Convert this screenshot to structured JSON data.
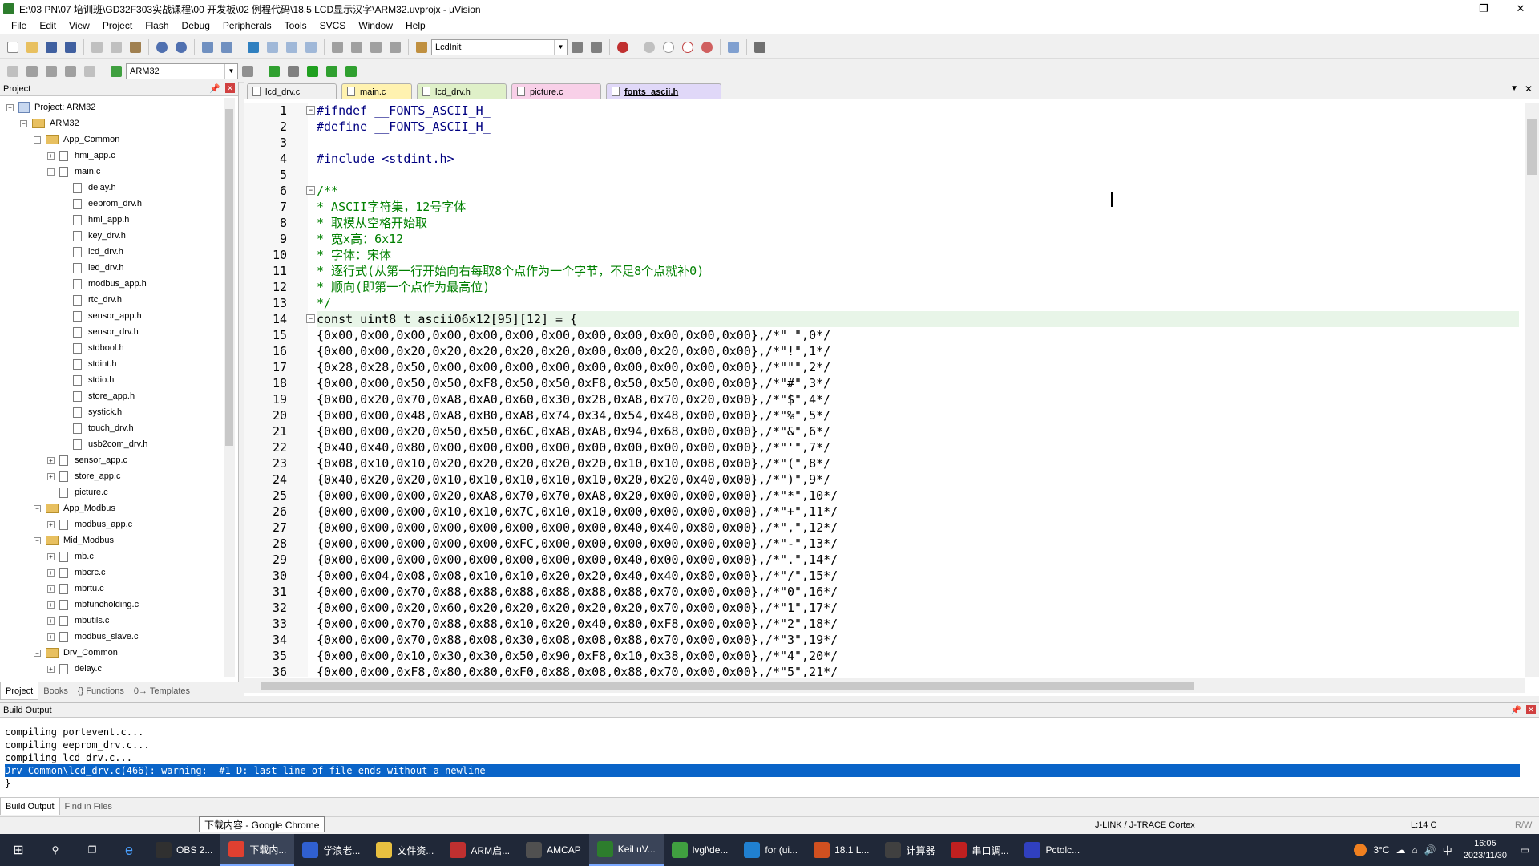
{
  "window": {
    "title": "E:\\03 PN\\07 培训班\\GD32F303实战课程\\00 开发板\\02 例程代码\\18.5 LCD显示汉字\\ARM32.uvprojx - µVision",
    "min": "–",
    "max": "❐",
    "close": "✕"
  },
  "menu": [
    "File",
    "Edit",
    "View",
    "Project",
    "Flash",
    "Debug",
    "Peripherals",
    "Tools",
    "SVCS",
    "Window",
    "Help"
  ],
  "toolbar1": {
    "function_combo": "LcdInit"
  },
  "toolbar2": {
    "target_combo": "ARM32"
  },
  "project_panel": {
    "title": "Project",
    "tree": [
      {
        "label": "Project: ARM32",
        "depth": 0,
        "exp": "−",
        "kind": "proj"
      },
      {
        "label": "ARM32",
        "depth": 1,
        "exp": "−",
        "kind": "dir"
      },
      {
        "label": "App_Common",
        "depth": 2,
        "exp": "−",
        "kind": "dir"
      },
      {
        "label": "hmi_app.c",
        "depth": 3,
        "exp": "+",
        "kind": "file"
      },
      {
        "label": "main.c",
        "depth": 3,
        "exp": "−",
        "kind": "file"
      },
      {
        "label": "delay.h",
        "depth": 4,
        "exp": "",
        "kind": "file"
      },
      {
        "label": "eeprom_drv.h",
        "depth": 4,
        "exp": "",
        "kind": "file"
      },
      {
        "label": "hmi_app.h",
        "depth": 4,
        "exp": "",
        "kind": "file"
      },
      {
        "label": "key_drv.h",
        "depth": 4,
        "exp": "",
        "kind": "file"
      },
      {
        "label": "lcd_drv.h",
        "depth": 4,
        "exp": "",
        "kind": "file"
      },
      {
        "label": "led_drv.h",
        "depth": 4,
        "exp": "",
        "kind": "file"
      },
      {
        "label": "modbus_app.h",
        "depth": 4,
        "exp": "",
        "kind": "file"
      },
      {
        "label": "rtc_drv.h",
        "depth": 4,
        "exp": "",
        "kind": "file"
      },
      {
        "label": "sensor_app.h",
        "depth": 4,
        "exp": "",
        "kind": "file"
      },
      {
        "label": "sensor_drv.h",
        "depth": 4,
        "exp": "",
        "kind": "file"
      },
      {
        "label": "stdbool.h",
        "depth": 4,
        "exp": "",
        "kind": "file"
      },
      {
        "label": "stdint.h",
        "depth": 4,
        "exp": "",
        "kind": "file"
      },
      {
        "label": "stdio.h",
        "depth": 4,
        "exp": "",
        "kind": "file"
      },
      {
        "label": "store_app.h",
        "depth": 4,
        "exp": "",
        "kind": "file"
      },
      {
        "label": "systick.h",
        "depth": 4,
        "exp": "",
        "kind": "file"
      },
      {
        "label": "touch_drv.h",
        "depth": 4,
        "exp": "",
        "kind": "file"
      },
      {
        "label": "usb2com_drv.h",
        "depth": 4,
        "exp": "",
        "kind": "file"
      },
      {
        "label": "sensor_app.c",
        "depth": 3,
        "exp": "+",
        "kind": "file"
      },
      {
        "label": "store_app.c",
        "depth": 3,
        "exp": "+",
        "kind": "file"
      },
      {
        "label": "picture.c",
        "depth": 3,
        "exp": "",
        "kind": "file"
      },
      {
        "label": "App_Modbus",
        "depth": 2,
        "exp": "−",
        "kind": "dir"
      },
      {
        "label": "modbus_app.c",
        "depth": 3,
        "exp": "+",
        "kind": "file"
      },
      {
        "label": "Mid_Modbus",
        "depth": 2,
        "exp": "−",
        "kind": "dir"
      },
      {
        "label": "mb.c",
        "depth": 3,
        "exp": "+",
        "kind": "file"
      },
      {
        "label": "mbcrc.c",
        "depth": 3,
        "exp": "+",
        "kind": "file"
      },
      {
        "label": "mbrtu.c",
        "depth": 3,
        "exp": "+",
        "kind": "file"
      },
      {
        "label": "mbfuncholding.c",
        "depth": 3,
        "exp": "+",
        "kind": "file"
      },
      {
        "label": "mbutils.c",
        "depth": 3,
        "exp": "+",
        "kind": "file"
      },
      {
        "label": "modbus_slave.c",
        "depth": 3,
        "exp": "+",
        "kind": "file"
      },
      {
        "label": "Drv_Common",
        "depth": 2,
        "exp": "−",
        "kind": "dir"
      },
      {
        "label": "delay.c",
        "depth": 3,
        "exp": "+",
        "kind": "file"
      }
    ],
    "bottom_tabs": [
      "Project",
      "Books",
      "{} Functions",
      "0→ Templates"
    ]
  },
  "editor": {
    "tabs": [
      {
        "label": "lcd_drv.c",
        "color": "#f0f0f0"
      },
      {
        "label": "main.c",
        "color": "#fff2b0"
      },
      {
        "label": "lcd_drv.h",
        "color": "#dff0c8"
      },
      {
        "label": "picture.c",
        "color": "#f8d0e8"
      },
      {
        "label": "fonts_ascii.h",
        "color": "#e0d8f8"
      }
    ],
    "active_tab": "fonts_ascii.h",
    "lines": [
      {
        "n": "1",
        "t": "#ifndef __FONTS_ASCII_H_",
        "c": "pp",
        "fold": "−"
      },
      {
        "n": "2",
        "t": "#define __FONTS_ASCII_H_",
        "c": "pp"
      },
      {
        "n": "3",
        "t": ""
      },
      {
        "n": "4",
        "t": "#include <stdint.h>",
        "c": "pp"
      },
      {
        "n": "5",
        "t": ""
      },
      {
        "n": "6",
        "t": "/**",
        "c": "cm",
        "fold": "−"
      },
      {
        "n": "7",
        "t": "* ASCII字符集，12号字体",
        "c": "cm"
      },
      {
        "n": "8",
        "t": "* 取模从空格开始取",
        "c": "cm"
      },
      {
        "n": "9",
        "t": "* 宽x高：6x12",
        "c": "cm"
      },
      {
        "n": "10",
        "t": "* 字体：宋体",
        "c": "cm"
      },
      {
        "n": "11",
        "t": "* 逐行式(从第一行开始向右每取8个点作为一个字节，不足8个点就补0)",
        "c": "cm"
      },
      {
        "n": "12",
        "t": "* 顺向(即第一个点作为最高位)",
        "c": "cm"
      },
      {
        "n": "13",
        "t": "*/",
        "c": "cm"
      },
      {
        "n": "14",
        "t": "const uint8_t ascii06x12[95][12] = {",
        "hl": true,
        "fold": "−"
      },
      {
        "n": "15",
        "t": "{0x00,0x00,0x00,0x00,0x00,0x00,0x00,0x00,0x00,0x00,0x00,0x00},/*\" \",0*/"
      },
      {
        "n": "16",
        "t": "{0x00,0x00,0x20,0x20,0x20,0x20,0x20,0x00,0x00,0x20,0x00,0x00},/*\"!\",1*/"
      },
      {
        "n": "17",
        "t": "{0x28,0x28,0x50,0x00,0x00,0x00,0x00,0x00,0x00,0x00,0x00,0x00},/*\"\"\",2*/"
      },
      {
        "n": "18",
        "t": "{0x00,0x00,0x50,0x50,0xF8,0x50,0x50,0xF8,0x50,0x50,0x00,0x00},/*\"#\",3*/"
      },
      {
        "n": "19",
        "t": "{0x00,0x20,0x70,0xA8,0xA0,0x60,0x30,0x28,0xA8,0x70,0x20,0x00},/*\"$\",4*/"
      },
      {
        "n": "20",
        "t": "{0x00,0x00,0x48,0xA8,0xB0,0xA8,0x74,0x34,0x54,0x48,0x00,0x00},/*\"%\",5*/"
      },
      {
        "n": "21",
        "t": "{0x00,0x00,0x20,0x50,0x50,0x6C,0xA8,0xA8,0x94,0x68,0x00,0x00},/*\"&\",6*/"
      },
      {
        "n": "22",
        "t": "{0x40,0x40,0x80,0x00,0x00,0x00,0x00,0x00,0x00,0x00,0x00,0x00},/*\"'\",7*/"
      },
      {
        "n": "23",
        "t": "{0x08,0x10,0x10,0x20,0x20,0x20,0x20,0x20,0x10,0x10,0x08,0x00},/*\"(\",8*/"
      },
      {
        "n": "24",
        "t": "{0x40,0x20,0x20,0x10,0x10,0x10,0x10,0x10,0x20,0x20,0x40,0x00},/*\")\",9*/"
      },
      {
        "n": "25",
        "t": "{0x00,0x00,0x00,0x20,0xA8,0x70,0x70,0xA8,0x20,0x00,0x00,0x00},/*\"*\",10*/"
      },
      {
        "n": "26",
        "t": "{0x00,0x00,0x00,0x10,0x10,0x7C,0x10,0x10,0x00,0x00,0x00,0x00},/*\"+\",11*/"
      },
      {
        "n": "27",
        "t": "{0x00,0x00,0x00,0x00,0x00,0x00,0x00,0x00,0x40,0x40,0x80,0x00},/*\",\",12*/"
      },
      {
        "n": "28",
        "t": "{0x00,0x00,0x00,0x00,0x00,0xFC,0x00,0x00,0x00,0x00,0x00,0x00},/*\"-\",13*/"
      },
      {
        "n": "29",
        "t": "{0x00,0x00,0x00,0x00,0x00,0x00,0x00,0x00,0x40,0x00,0x00,0x00},/*\".\",14*/"
      },
      {
        "n": "30",
        "t": "{0x00,0x04,0x08,0x08,0x10,0x10,0x20,0x20,0x40,0x40,0x80,0x00},/*\"/\",15*/"
      },
      {
        "n": "31",
        "t": "{0x00,0x00,0x70,0x88,0x88,0x88,0x88,0x88,0x88,0x70,0x00,0x00},/*\"0\",16*/"
      },
      {
        "n": "32",
        "t": "{0x00,0x00,0x20,0x60,0x20,0x20,0x20,0x20,0x20,0x70,0x00,0x00},/*\"1\",17*/"
      },
      {
        "n": "33",
        "t": "{0x00,0x00,0x70,0x88,0x88,0x10,0x20,0x40,0x80,0xF8,0x00,0x00},/*\"2\",18*/"
      },
      {
        "n": "34",
        "t": "{0x00,0x00,0x70,0x88,0x08,0x30,0x08,0x08,0x88,0x70,0x00,0x00},/*\"3\",19*/"
      },
      {
        "n": "35",
        "t": "{0x00,0x00,0x10,0x30,0x30,0x50,0x90,0xF8,0x10,0x38,0x00,0x00},/*\"4\",20*/"
      },
      {
        "n": "36",
        "t": "{0x00,0x00,0xF8,0x80,0x80,0xF0,0x88,0x08,0x88,0x70,0x00,0x00},/*\"5\",21*/"
      }
    ]
  },
  "build_output": {
    "title": "Build Output",
    "lines": [
      "compiling portevent.c...",
      "compiling eeprom_drv.c...",
      "compiling lcd_drv.c...",
      "Drv Common\\lcd_drv.c(466): warning:  #1-D: last line of file ends without a newline",
      "}"
    ],
    "selected_line": 3,
    "tabs": [
      "Build Output",
      "Find in Files"
    ]
  },
  "status": {
    "debugger": "J-LINK / J-TRACE Cortex",
    "position": "L:14 C",
    "mode": "R/W"
  },
  "tooltip": "下载内容 - Google Chrome",
  "taskbar": {
    "apps": [
      {
        "label": "OBS 2...",
        "color": "#303030"
      },
      {
        "label": "下载内...",
        "color": "#e04030",
        "active": true
      },
      {
        "label": "学浪老...",
        "color": "#3060d0"
      },
      {
        "label": "文件资...",
        "color": "#e8c040"
      },
      {
        "label": "ARM启...",
        "color": "#c03030"
      },
      {
        "label": "AMCAP",
        "color": "#505050"
      },
      {
        "label": "Keil uV...",
        "color": "#2d7d2d",
        "active": true
      },
      {
        "label": "lvgl\\de...",
        "color": "#40a040"
      },
      {
        "label": "for (ui...",
        "color": "#2080d0"
      },
      {
        "label": "18.1 L...",
        "color": "#d05020"
      },
      {
        "label": "计算器",
        "color": "#404040"
      },
      {
        "label": "串口调...",
        "color": "#c02020"
      },
      {
        "label": "Pctolc...",
        "color": "#3040c0"
      }
    ],
    "weather": "3°C",
    "ime": "中",
    "time": "16:05",
    "date": "2023/11/30"
  }
}
